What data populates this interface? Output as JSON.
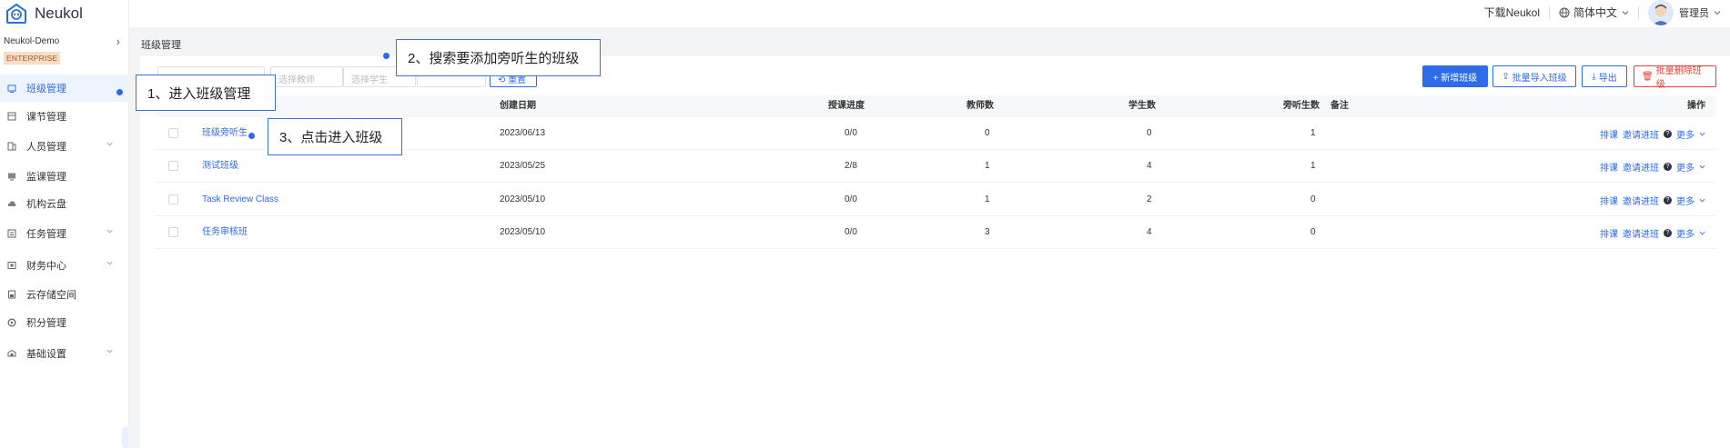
{
  "app": {
    "logo_text": "Neukol"
  },
  "org": {
    "name": "Neukol-Demo",
    "badge": "ENTERPRISE"
  },
  "sidebar": {
    "items": [
      {
        "label": "班级管理",
        "icon": "classroom-icon",
        "active": true,
        "has_caret": false
      },
      {
        "label": "课节管理",
        "icon": "lesson-icon",
        "active": false,
        "has_caret": false
      },
      {
        "label": "人员管理",
        "icon": "people-icon",
        "active": false,
        "has_caret": true
      },
      {
        "label": "监课管理",
        "icon": "monitor-icon",
        "active": false,
        "has_caret": false
      },
      {
        "label": "机构云盘",
        "icon": "cloud-icon",
        "active": false,
        "has_caret": false
      },
      {
        "label": "任务管理",
        "icon": "task-icon",
        "active": false,
        "has_caret": true
      },
      {
        "label": "财务中心",
        "icon": "finance-icon",
        "active": false,
        "has_caret": true
      },
      {
        "label": "云存储空间",
        "icon": "storage-icon",
        "active": false,
        "has_caret": false
      },
      {
        "label": "积分管理",
        "icon": "points-icon",
        "active": false,
        "has_caret": false
      },
      {
        "label": "基础设置",
        "icon": "settings-icon",
        "active": false,
        "has_caret": true
      }
    ]
  },
  "header": {
    "download": "下载Neukol",
    "language": "简体中文",
    "user": "管理员"
  },
  "breadcrumb": "班级管理",
  "filters": {
    "teacher_placeholder": "选择教师",
    "student_placeholder": "选择学生",
    "reset_label": "重置"
  },
  "toolbar": {
    "add": "+ 新增班级",
    "batch_import": "批量导入班级",
    "export": "导出",
    "batch_delete": "批量删除班级"
  },
  "table": {
    "columns": {
      "date": "创建日期",
      "progress": "授课进度",
      "teachers": "教师数",
      "students": "学生数",
      "auditors": "旁听生数",
      "remark": "备注",
      "actions": "操作"
    },
    "rows": [
      {
        "name": "班级旁听生",
        "date": "2023/06/13",
        "progress": "0/0",
        "teachers": "0",
        "students": "0",
        "auditors": "1"
      },
      {
        "name": "测试班级",
        "date": "2023/05/25",
        "progress": "2/8",
        "teachers": "1",
        "students": "4",
        "auditors": "1"
      },
      {
        "name": "Task Review Class",
        "date": "2023/05/10",
        "progress": "0/0",
        "teachers": "1",
        "students": "2",
        "auditors": "0"
      },
      {
        "name": "任务审核班",
        "date": "2023/05/10",
        "progress": "0/0",
        "teachers": "3",
        "students": "4",
        "auditors": "0"
      }
    ],
    "row_actions": {
      "schedule": "排课",
      "invite": "邀请进班",
      "more": "更多"
    }
  },
  "callouts": {
    "step1": "1、进入班级管理",
    "step2": "2、搜索要添加旁听生的班级",
    "step3": "3、点击进入班级"
  },
  "colors": {
    "primary": "#2e6be6",
    "danger": "#e3413a",
    "callout_border": "#3a72e0"
  }
}
